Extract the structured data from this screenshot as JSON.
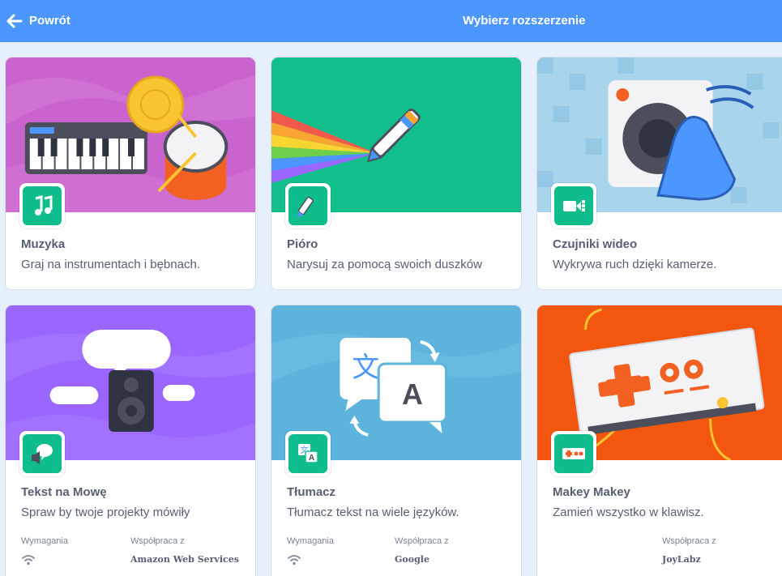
{
  "header": {
    "back_label": "Powrót",
    "title": "Wybierz rozszerzenie"
  },
  "cards": [
    {
      "name": "Muzyka",
      "description": "Graj na instrumentach i bębnach.",
      "icon": "music-notes-icon",
      "banner_color": "#c964ce"
    },
    {
      "name": "Pióro",
      "description": "Narysuj za pomocą swoich duszków",
      "icon": "pen-icon",
      "banner_color": "#12bf8c"
    },
    {
      "name": "Czujniki wideo",
      "description": "Wykrywa ruch dzięki kamerze.",
      "icon": "video-camera-icon",
      "banner_color": "#a9d5ec"
    },
    {
      "name": "Tekst na Mowę",
      "description": "Spraw by twoje projekty mówiły",
      "icon": "speaker-bubble-icon",
      "banner_color": "#9a66ff",
      "requirements_label": "Wymagania",
      "collab_label": "Współpraca z",
      "collab_value": "Amazon Web Services",
      "requires": "wifi-icon"
    },
    {
      "name": "Tłumacz",
      "description": "Tłumacz tekst na wiele języków.",
      "icon": "translate-icon",
      "banner_color": "#5cb4dd",
      "requirements_label": "Wymagania",
      "collab_label": "Współpraca z",
      "collab_value": "Google",
      "requires": "wifi-icon"
    },
    {
      "name": "Makey Makey",
      "description": "Zamień wszystko w klawisz.",
      "icon": "makey-controller-icon",
      "banner_color": "#f2560f",
      "collab_label": "Współpraca z",
      "collab_value": "JoyLabz"
    }
  ]
}
